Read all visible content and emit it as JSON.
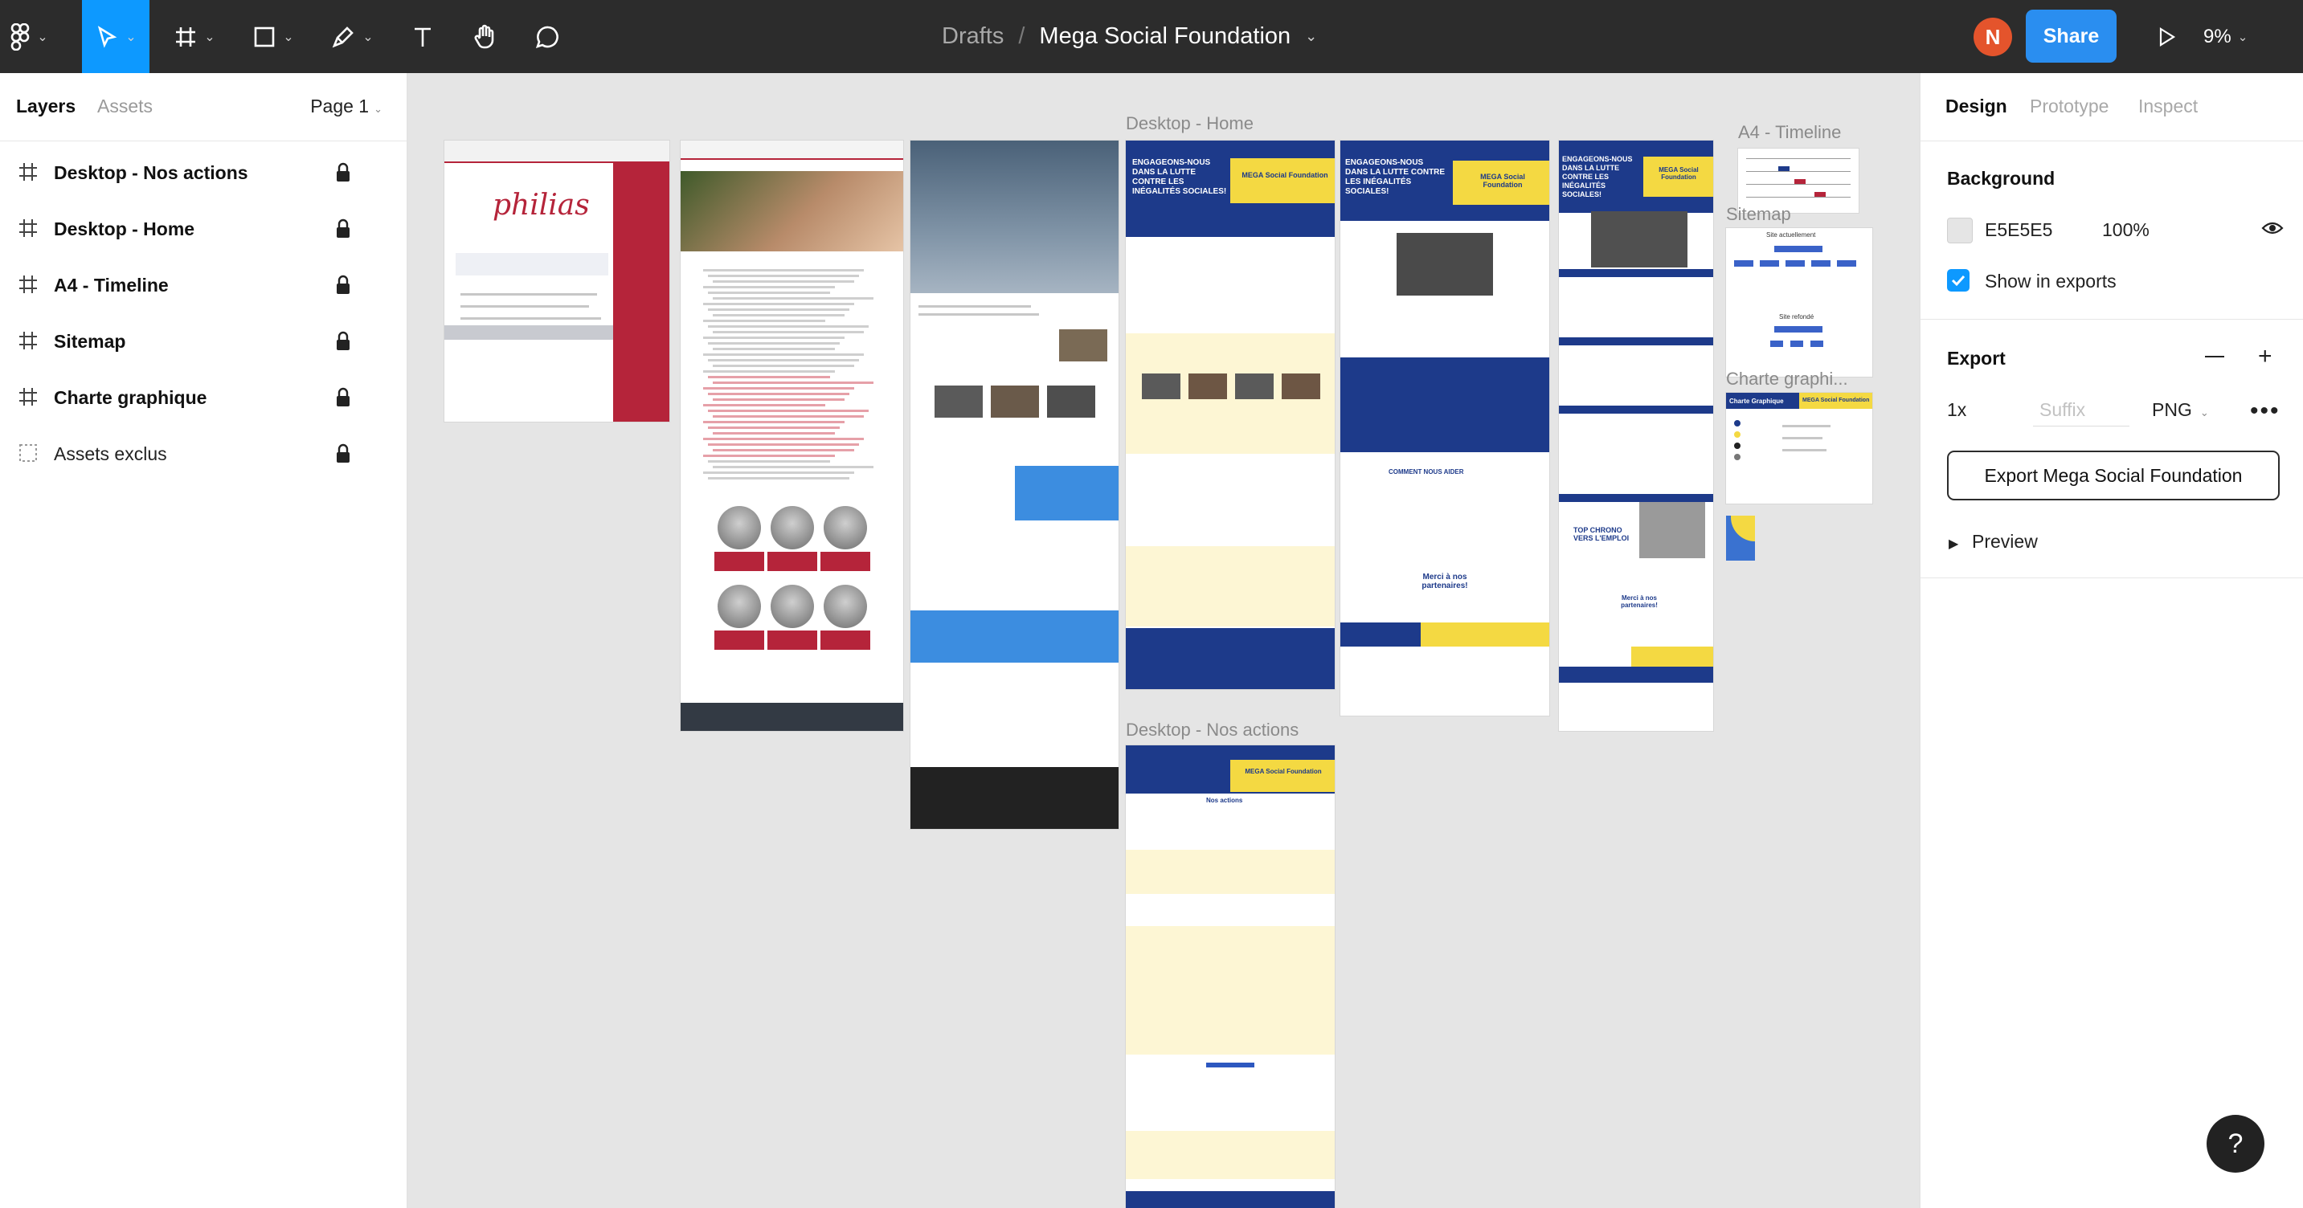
{
  "toolbar": {
    "breadcrumb_parent": "Drafts",
    "breadcrumb_separator": "/",
    "file_title": "Mega Social Foundation",
    "avatar_initial": "N",
    "avatar_color": "#e4542c",
    "share_label": "Share",
    "share_color": "#2a8ef0",
    "zoom_level": "9%",
    "tools": [
      "main-menu-icon",
      "move-tool-icon",
      "frame-tool-icon",
      "shape-tool-icon",
      "pen-tool-icon",
      "text-tool-icon",
      "hand-tool-icon",
      "comment-tool-icon"
    ],
    "active_tool": "move-tool-icon"
  },
  "left_panel": {
    "tab_layers": "Layers",
    "tab_assets": "Assets",
    "page_selector": "Page 1",
    "layers": [
      {
        "name": "Desktop - Nos actions",
        "icon": "frame-icon",
        "locked": true
      },
      {
        "name": "Desktop - Home",
        "icon": "frame-icon",
        "locked": true
      },
      {
        "name": "A4 - Timeline",
        "icon": "frame-icon",
        "locked": true
      },
      {
        "name": "Sitemap",
        "icon": "frame-icon",
        "locked": true
      },
      {
        "name": "Charte graphique",
        "icon": "frame-icon",
        "locked": true
      },
      {
        "name": "Assets exclus",
        "icon": "group-icon",
        "locked": true
      }
    ]
  },
  "canvas": {
    "background": "#E5E5E5",
    "frame_labels": {
      "home": "Desktop - Home",
      "nos_actions": "Desktop - Nos actions",
      "timeline": "A4 - Timeline",
      "sitemap": "Sitemap",
      "charte": "Charte graphi..."
    },
    "frame_texts": {
      "philias_logo": "philias",
      "hero_title": "ENGAGEONS-NOUS DANS LA LUTTE CONTRE LES INÉGALITÉS SOCIALES!",
      "brand": "MEGA Social Foundation",
      "merci": "Merci à nos partenaires!",
      "comment_aider": "COMMENT NOUS AIDER",
      "nos_actions": "Nos actions",
      "top_chrono": "TOP CHRONO VERS L'EMPLOI",
      "site_actuel": "Site actuellement",
      "site_refonte": "Site refondé",
      "charte_title": "Charte Graphique",
      "charte_brand": "MEGA Social Foundation"
    },
    "brand_colors": {
      "navy": "#1d3a8a",
      "yellow": "#f4d942",
      "cream": "#fdf6d4",
      "philias_red": "#b5243a"
    }
  },
  "right_panel": {
    "tab_design": "Design",
    "tab_prototype": "Prototype",
    "tab_inspect": "Inspect",
    "background_heading": "Background",
    "background_hex": "E5E5E5",
    "background_opacity": "100%",
    "show_in_exports_label": "Show in exports",
    "show_in_exports_checked": true,
    "export_heading": "Export",
    "export_scale": "1x",
    "export_suffix_placeholder": "Suffix",
    "export_format": "PNG",
    "export_button_label": "Export Mega Social Foundation",
    "preview_label": "Preview"
  },
  "help_label": "?"
}
